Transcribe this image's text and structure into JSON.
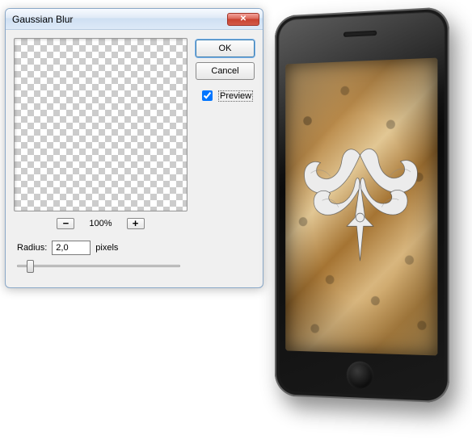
{
  "dialog": {
    "title": "Gaussian Blur",
    "ok_label": "OK",
    "cancel_label": "Cancel",
    "preview_label": "Preview",
    "preview_checked": true,
    "zoom_level": "100%",
    "zoom_out_glyph": "−",
    "zoom_in_glyph": "+",
    "radius_label": "Radius:",
    "radius_value": "2,0",
    "radius_units": "pixels",
    "close_glyph": "✕"
  }
}
